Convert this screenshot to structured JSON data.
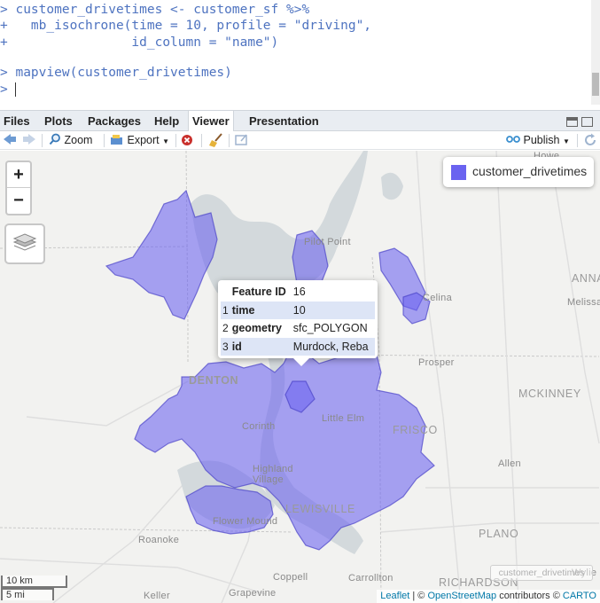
{
  "console": {
    "lines": [
      "> customer_drivetimes <- customer_sf %>%",
      "+   mb_isochrone(time = 10, profile = \"driving\",",
      "+                id_column = \"name\")",
      "",
      "> mapview(customer_drivetimes)",
      "> "
    ]
  },
  "tabs": [
    "Files",
    "Plots",
    "Packages",
    "Help",
    "Viewer",
    "Presentation"
  ],
  "toolbar": {
    "zoom": "Zoom",
    "export": "Export",
    "publish": "Publish"
  },
  "legend": {
    "label": "customer_drivetimes",
    "color": "#6a63f0"
  },
  "popup": {
    "rows": [
      {
        "num": "",
        "key": "Feature ID",
        "value": "16"
      },
      {
        "num": "1",
        "key": "time",
        "value": "10"
      },
      {
        "num": "2",
        "key": "geometry",
        "value": "sfc_POLYGON"
      },
      {
        "num": "3",
        "key": "id",
        "value": "Murdock, Reba"
      }
    ]
  },
  "map_labels": {
    "howe": "Howe",
    "pilot_point": "Pilot Point",
    "celina": "Celina",
    "anna": "ANNA",
    "melissa": "Melissa",
    "prosper": "Prosper",
    "denton": "DENTON",
    "mckinney": "MCKINNEY",
    "little_elm": "Little Elm",
    "frisco": "FRISCO",
    "corinth": "Corinth",
    "allen": "Allen",
    "highland_village": "Highland Village",
    "lewisville": "LEWISVILLE",
    "flower_mound": "Flower Mound",
    "roanoke": "Roanoke",
    "plano": "PLANO",
    "coppell": "Coppell",
    "carrollton": "Carrollton",
    "richardson": "RICHARDSON",
    "keller": "Keller",
    "grapevine": "Grapevine",
    "wylie": "Wylie"
  },
  "scale": {
    "km": "10 km",
    "mi": "5 mi"
  },
  "mini_legend": "customer_drivetimes",
  "attribution": {
    "leaflet": "Leaflet",
    "sep": "| ©",
    "osm": "OpenStreetMap",
    "mid": "contributors ©",
    "carto": "CARTO"
  },
  "colors": {
    "isochrone_fill": "#6a63f0",
    "water": "#d4dadc",
    "map_bg": "#f2f2f0",
    "console_text": "#4e73c0"
  }
}
